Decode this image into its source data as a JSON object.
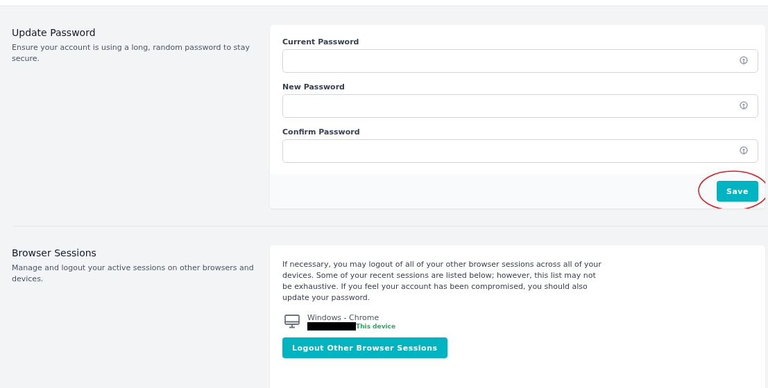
{
  "sections": [
    {
      "title": "Update Password",
      "description": "Ensure your account is using a long, random password to stay secure.",
      "kind": "password"
    },
    {
      "title": "Browser Sessions",
      "description": "Manage and logout your active sessions on other browsers and devices.",
      "kind": "sessions"
    }
  ],
  "password_form": {
    "fields": [
      {
        "label": "Current Password"
      },
      {
        "label": "New Password"
      },
      {
        "label": "Confirm Password"
      }
    ],
    "save_button": "Save",
    "save_highlighted": true
  },
  "sessions": {
    "intro": "If necessary, you may logout of all of your other browser sessions across all of your devices. Some of your recent sessions are listed below; however, this list may not be exhaustive. If you feel your account has been compromised, you should also update your password.",
    "items": [
      {
        "name": "Windows - Chrome",
        "redacted": true,
        "note": "This device"
      }
    ],
    "logout_button": "Logout Other Browser Sessions"
  }
}
